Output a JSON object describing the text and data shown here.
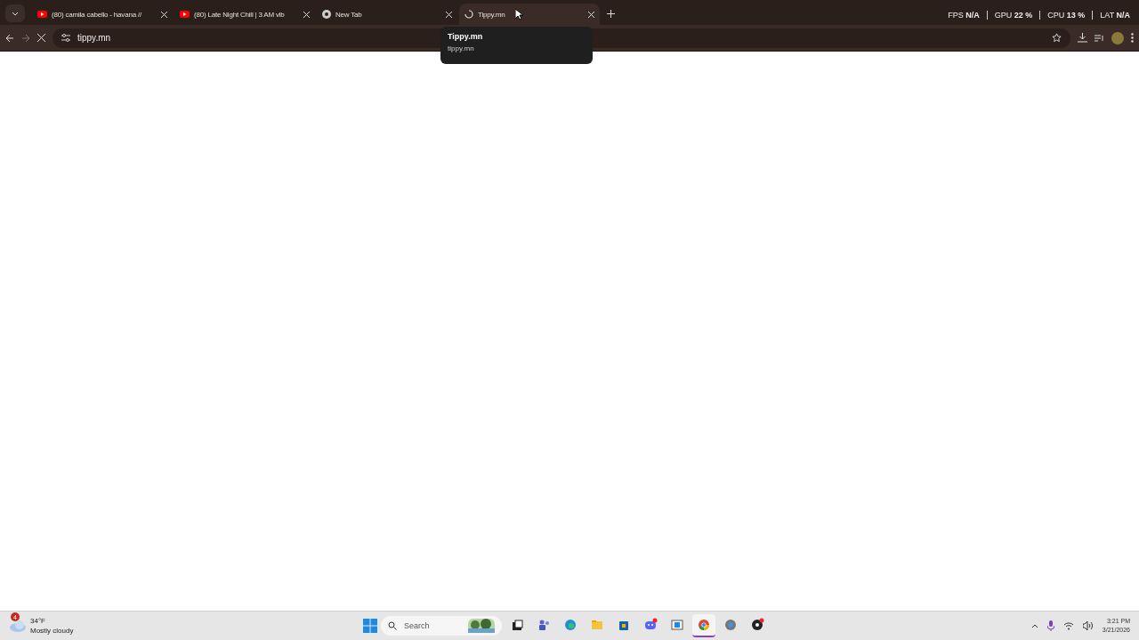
{
  "tabs": [
    {
      "title": "(80) camila cabello - havana //",
      "kind": "youtube",
      "selected": false
    },
    {
      "title": "(80) Late Night Chill | 3 AM vib",
      "kind": "youtube",
      "selected": false
    },
    {
      "title": "New Tab",
      "kind": "chrome",
      "selected": false
    },
    {
      "title": "Tippy.mn",
      "kind": "loading",
      "selected": true
    }
  ],
  "tooltip": {
    "title": "Tippy.mn",
    "url": "tippy.mn"
  },
  "address": "tippy.mn",
  "stats": [
    {
      "label": "FPS",
      "value": "N/A"
    },
    {
      "label": "GPU",
      "value": "22 %"
    },
    {
      "label": "CPU",
      "value": "13 %"
    },
    {
      "label": "LAT",
      "value": "N/A"
    }
  ],
  "weather": {
    "badge": "4",
    "temp": "34°F",
    "condition": "Mostly cloudy"
  },
  "taskbar": {
    "search_placeholder": "Search",
    "apps": [
      {
        "kind": "files-dark",
        "active": false
      },
      {
        "kind": "teams",
        "active": false
      },
      {
        "kind": "edge",
        "active": false
      },
      {
        "kind": "folder",
        "active": false
      },
      {
        "kind": "store",
        "active": false
      },
      {
        "kind": "discord",
        "active": false
      },
      {
        "kind": "window",
        "active": false
      },
      {
        "kind": "chrome",
        "active": true
      },
      {
        "kind": "settings",
        "active": false
      },
      {
        "kind": "obs",
        "active": false
      }
    ]
  },
  "clock": {
    "time": "3:21 PM",
    "date": "3/21/2026"
  }
}
